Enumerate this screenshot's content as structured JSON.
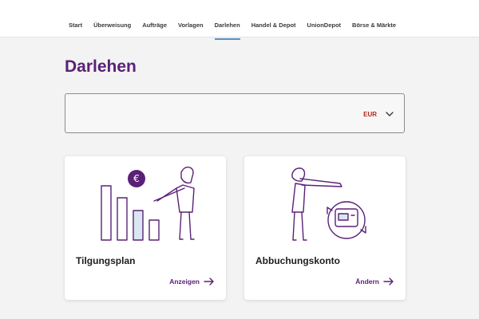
{
  "nav": {
    "items": [
      {
        "label": "Start",
        "active": false
      },
      {
        "label": "Überweisung",
        "active": false
      },
      {
        "label": "Aufträge",
        "active": false
      },
      {
        "label": "Vorlagen",
        "active": false
      },
      {
        "label": "Darlehen",
        "active": true
      },
      {
        "label": "Handel & Depot",
        "active": false
      },
      {
        "label": "UnionDepot",
        "active": false
      },
      {
        "label": "Börse & Märkte",
        "active": false
      }
    ]
  },
  "page": {
    "title": "Darlehen"
  },
  "account_select": {
    "value": "",
    "currency": "EUR",
    "icon": "chevron-down-icon"
  },
  "cards": [
    {
      "title": "Tilgungsplan",
      "action": "Anzeigen",
      "illustration": "repayment-chart-illustration",
      "action_icon": "arrow-right-icon"
    },
    {
      "title": "Abbuchungskonto",
      "action": "Ändern",
      "illustration": "account-change-illustration",
      "action_icon": "arrow-right-icon"
    }
  ],
  "colors": {
    "brand_purple": "#5a2177",
    "currency_red": "#b3261e",
    "nav_underline": "#5b8fc4",
    "chart_fill": "#dbe6f3"
  }
}
